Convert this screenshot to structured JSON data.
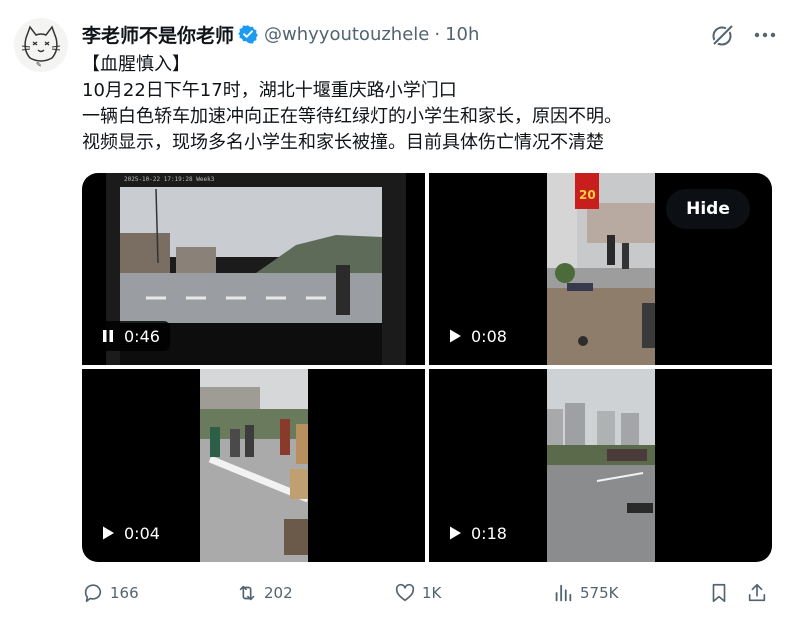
{
  "post": {
    "author_name": "李老师不是你老师",
    "handle": "@whyyoutouzhele",
    "separator": "·",
    "time": "10h",
    "text": {
      "line1": "【血腥慎入】",
      "line2": "10月22日下午17时，湖北十堰重庆路小学门口",
      "line3": "一辆白色轿车加速冲向正在等待红绿灯的小学生和家长，原因不明。",
      "line4": "视频显示，现场多名小学生和家长被撞。目前具体伤亡情况不清楚"
    }
  },
  "media": {
    "videos": [
      {
        "duration": "0:46",
        "state": "pause-icon",
        "timestamp_overlay": "2025-10-22 17:19:28 Week3"
      },
      {
        "duration": "0:08",
        "state": "play-icon",
        "sign_text": "20"
      },
      {
        "duration": "0:04",
        "state": "play-icon"
      },
      {
        "duration": "0:18",
        "state": "play-icon"
      }
    ],
    "hide_label": "Hide"
  },
  "actions": {
    "replies": "166",
    "reposts": "202",
    "likes": "1K",
    "views": "575K"
  },
  "icons": [
    "verified-badge-icon",
    "grok-icon",
    "more-icon",
    "reply-icon",
    "repost-icon",
    "like-icon",
    "views-icon",
    "bookmark-icon",
    "share-icon"
  ],
  "colors": {
    "verified": "#1d9bf0",
    "text_primary": "#0f1419",
    "text_secondary": "#536471"
  }
}
